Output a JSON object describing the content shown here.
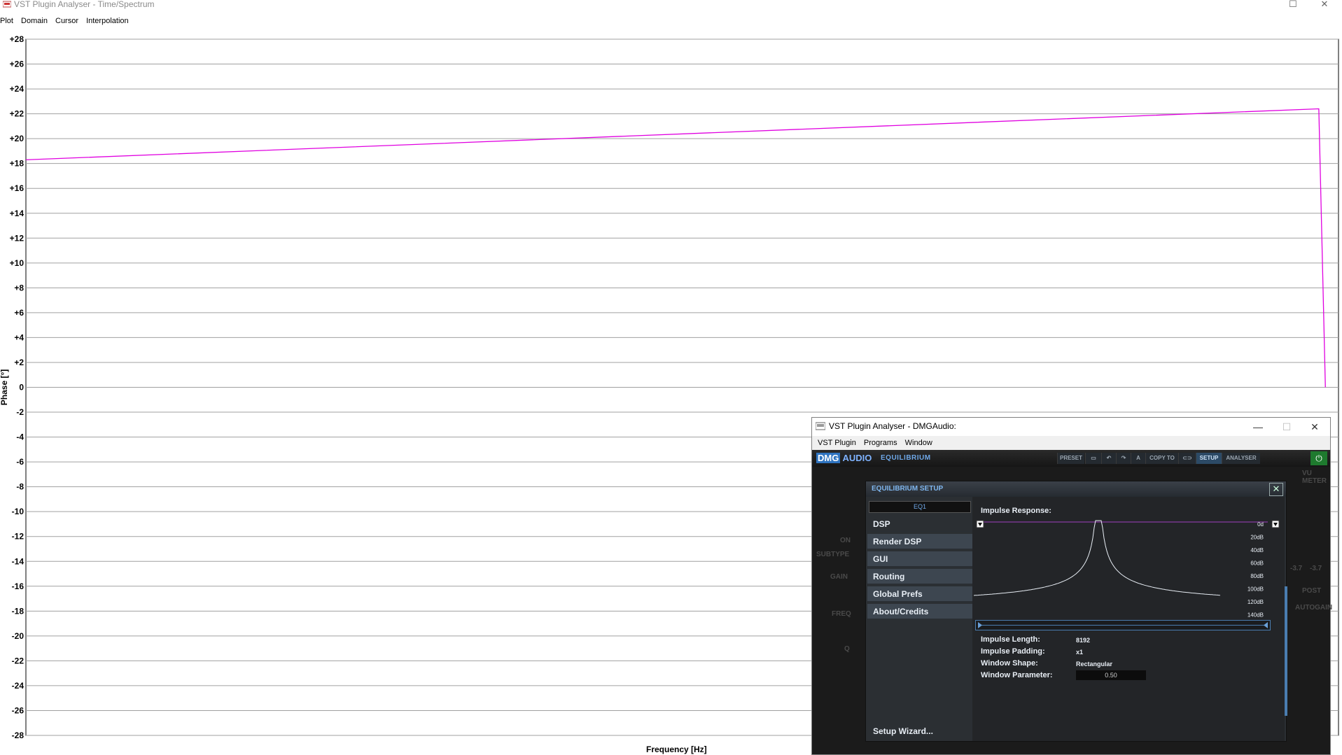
{
  "main_window": {
    "title": "VST Plugin Analyser - Time/Spectrum",
    "menu": [
      "Plot",
      "Domain",
      "Cursor",
      "Interpolation"
    ]
  },
  "colors": {
    "trace": "#e000e0",
    "grid": "#a0a0a0",
    "accent": "#4a7db0"
  },
  "chart_data": {
    "type": "line",
    "ylabel": "Phase [°]",
    "xlabel": "Frequency [Hz]",
    "ylim": [
      -28,
      28
    ],
    "y_ticks": [
      "+28",
      "+26",
      "+24",
      "+22",
      "+20",
      "+18",
      "+16",
      "+14",
      "+12",
      "+10",
      "+8",
      "+6",
      "+4",
      "+2",
      "0",
      "-2",
      "-4",
      "-6",
      "-8",
      "-10",
      "-12",
      "-14",
      "-16",
      "-18",
      "-20",
      "-22",
      "-24",
      "-26",
      "-28"
    ],
    "grid": true,
    "series": [
      {
        "x": [
          0,
          0.985,
          0.99
        ],
        "y": [
          18.3,
          22.4,
          0
        ]
      }
    ]
  },
  "plugin_window": {
    "title": "VST Plugin Analyser - DMGAudio:",
    "menu": [
      "VST Plugin",
      "Programs",
      "Window"
    ],
    "brand": {
      "logo_a": "DMG",
      "logo_b": "AUDIO",
      "product": "EQUILIBRIUM"
    },
    "toolbar": [
      "PRESET",
      "A",
      "COPY TO",
      "SETUP",
      "ANALYSER"
    ],
    "background_labels": [
      "ON",
      "SUBTYPE",
      "GAIN",
      "FREQ",
      "Q",
      "VU METER",
      "POST",
      "AUTOGAIN",
      "-3.7",
      "-3.7"
    ]
  },
  "setup": {
    "title": "EQUILIBRIUM SETUP",
    "eq_selector": "EQ1",
    "nav": [
      "DSP",
      "Render DSP",
      "GUI",
      "Routing",
      "Global Prefs",
      "About/Credits"
    ],
    "selected_nav": "DSP",
    "wizard": "Setup Wizard...",
    "impulse_label": "Impulse Response:",
    "db_ticks": [
      "0d",
      "20dB",
      "40dB",
      "60dB",
      "80dB",
      "100dB",
      "120dB",
      "140dB"
    ],
    "fields": [
      {
        "label": "Impulse Length:",
        "value": "8192"
      },
      {
        "label": "Impulse Padding:",
        "value": "x1"
      },
      {
        "label": "Window Shape:",
        "value": "Rectangular"
      },
      {
        "label": "Window Parameter:",
        "value": "0.50"
      }
    ]
  }
}
